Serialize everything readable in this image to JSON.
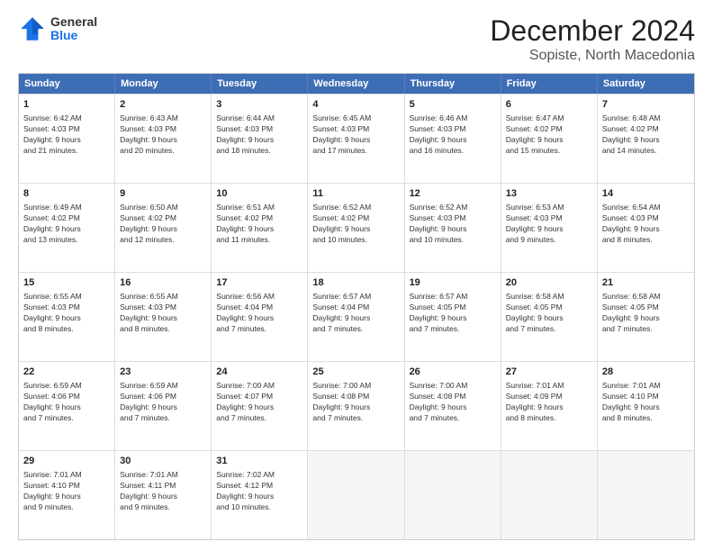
{
  "header": {
    "logo": {
      "general": "General",
      "blue": "Blue"
    },
    "month_title": "December 2024",
    "subtitle": "Sopiste, North Macedonia"
  },
  "weekdays": [
    "Sunday",
    "Monday",
    "Tuesday",
    "Wednesday",
    "Thursday",
    "Friday",
    "Saturday"
  ],
  "rows": [
    [
      {
        "day": "1",
        "lines": [
          "Sunrise: 6:42 AM",
          "Sunset: 4:03 PM",
          "Daylight: 9 hours",
          "and 21 minutes."
        ]
      },
      {
        "day": "2",
        "lines": [
          "Sunrise: 6:43 AM",
          "Sunset: 4:03 PM",
          "Daylight: 9 hours",
          "and 20 minutes."
        ]
      },
      {
        "day": "3",
        "lines": [
          "Sunrise: 6:44 AM",
          "Sunset: 4:03 PM",
          "Daylight: 9 hours",
          "and 18 minutes."
        ]
      },
      {
        "day": "4",
        "lines": [
          "Sunrise: 6:45 AM",
          "Sunset: 4:03 PM",
          "Daylight: 9 hours",
          "and 17 minutes."
        ]
      },
      {
        "day": "5",
        "lines": [
          "Sunrise: 6:46 AM",
          "Sunset: 4:03 PM",
          "Daylight: 9 hours",
          "and 16 minutes."
        ]
      },
      {
        "day": "6",
        "lines": [
          "Sunrise: 6:47 AM",
          "Sunset: 4:02 PM",
          "Daylight: 9 hours",
          "and 15 minutes."
        ]
      },
      {
        "day": "7",
        "lines": [
          "Sunrise: 6:48 AM",
          "Sunset: 4:02 PM",
          "Daylight: 9 hours",
          "and 14 minutes."
        ]
      }
    ],
    [
      {
        "day": "8",
        "lines": [
          "Sunrise: 6:49 AM",
          "Sunset: 4:02 PM",
          "Daylight: 9 hours",
          "and 13 minutes."
        ]
      },
      {
        "day": "9",
        "lines": [
          "Sunrise: 6:50 AM",
          "Sunset: 4:02 PM",
          "Daylight: 9 hours",
          "and 12 minutes."
        ]
      },
      {
        "day": "10",
        "lines": [
          "Sunrise: 6:51 AM",
          "Sunset: 4:02 PM",
          "Daylight: 9 hours",
          "and 11 minutes."
        ]
      },
      {
        "day": "11",
        "lines": [
          "Sunrise: 6:52 AM",
          "Sunset: 4:02 PM",
          "Daylight: 9 hours",
          "and 10 minutes."
        ]
      },
      {
        "day": "12",
        "lines": [
          "Sunrise: 6:52 AM",
          "Sunset: 4:03 PM",
          "Daylight: 9 hours",
          "and 10 minutes."
        ]
      },
      {
        "day": "13",
        "lines": [
          "Sunrise: 6:53 AM",
          "Sunset: 4:03 PM",
          "Daylight: 9 hours",
          "and 9 minutes."
        ]
      },
      {
        "day": "14",
        "lines": [
          "Sunrise: 6:54 AM",
          "Sunset: 4:03 PM",
          "Daylight: 9 hours",
          "and 8 minutes."
        ]
      }
    ],
    [
      {
        "day": "15",
        "lines": [
          "Sunrise: 6:55 AM",
          "Sunset: 4:03 PM",
          "Daylight: 9 hours",
          "and 8 minutes."
        ]
      },
      {
        "day": "16",
        "lines": [
          "Sunrise: 6:55 AM",
          "Sunset: 4:03 PM",
          "Daylight: 9 hours",
          "and 8 minutes."
        ]
      },
      {
        "day": "17",
        "lines": [
          "Sunrise: 6:56 AM",
          "Sunset: 4:04 PM",
          "Daylight: 9 hours",
          "and 7 minutes."
        ]
      },
      {
        "day": "18",
        "lines": [
          "Sunrise: 6:57 AM",
          "Sunset: 4:04 PM",
          "Daylight: 9 hours",
          "and 7 minutes."
        ]
      },
      {
        "day": "19",
        "lines": [
          "Sunrise: 6:57 AM",
          "Sunset: 4:05 PM",
          "Daylight: 9 hours",
          "and 7 minutes."
        ]
      },
      {
        "day": "20",
        "lines": [
          "Sunrise: 6:58 AM",
          "Sunset: 4:05 PM",
          "Daylight: 9 hours",
          "and 7 minutes."
        ]
      },
      {
        "day": "21",
        "lines": [
          "Sunrise: 6:58 AM",
          "Sunset: 4:05 PM",
          "Daylight: 9 hours",
          "and 7 minutes."
        ]
      }
    ],
    [
      {
        "day": "22",
        "lines": [
          "Sunrise: 6:59 AM",
          "Sunset: 4:06 PM",
          "Daylight: 9 hours",
          "and 7 minutes."
        ]
      },
      {
        "day": "23",
        "lines": [
          "Sunrise: 6:59 AM",
          "Sunset: 4:06 PM",
          "Daylight: 9 hours",
          "and 7 minutes."
        ]
      },
      {
        "day": "24",
        "lines": [
          "Sunrise: 7:00 AM",
          "Sunset: 4:07 PM",
          "Daylight: 9 hours",
          "and 7 minutes."
        ]
      },
      {
        "day": "25",
        "lines": [
          "Sunrise: 7:00 AM",
          "Sunset: 4:08 PM",
          "Daylight: 9 hours",
          "and 7 minutes."
        ]
      },
      {
        "day": "26",
        "lines": [
          "Sunrise: 7:00 AM",
          "Sunset: 4:08 PM",
          "Daylight: 9 hours",
          "and 7 minutes."
        ]
      },
      {
        "day": "27",
        "lines": [
          "Sunrise: 7:01 AM",
          "Sunset: 4:09 PM",
          "Daylight: 9 hours",
          "and 8 minutes."
        ]
      },
      {
        "day": "28",
        "lines": [
          "Sunrise: 7:01 AM",
          "Sunset: 4:10 PM",
          "Daylight: 9 hours",
          "and 8 minutes."
        ]
      }
    ],
    [
      {
        "day": "29",
        "lines": [
          "Sunrise: 7:01 AM",
          "Sunset: 4:10 PM",
          "Daylight: 9 hours",
          "and 9 minutes."
        ]
      },
      {
        "day": "30",
        "lines": [
          "Sunrise: 7:01 AM",
          "Sunset: 4:11 PM",
          "Daylight: 9 hours",
          "and 9 minutes."
        ]
      },
      {
        "day": "31",
        "lines": [
          "Sunrise: 7:02 AM",
          "Sunset: 4:12 PM",
          "Daylight: 9 hours",
          "and 10 minutes."
        ]
      },
      null,
      null,
      null,
      null
    ]
  ]
}
